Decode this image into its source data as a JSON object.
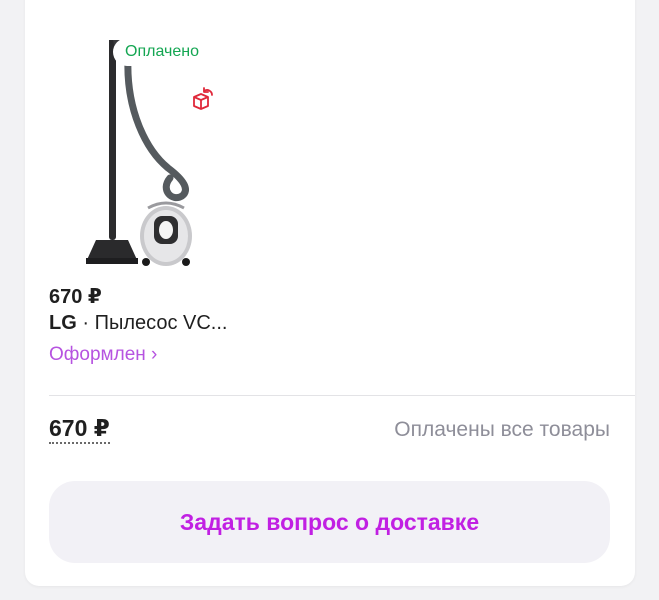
{
  "order": {
    "badge_paid": "Оплачено",
    "item": {
      "price": "670 ₽",
      "brand": "LG",
      "separator": " · ",
      "name": "Пылесос VC...",
      "status_link": "Оформлен ›",
      "image_icon": "vacuum-cleaner-image",
      "return_icon": "box-return-icon"
    },
    "total": {
      "price": "670 ₽",
      "status": "Оплачены все товары"
    },
    "ask_delivery_button": "Задать вопрос о доставке"
  },
  "colors": {
    "accent": "#c120e3",
    "link": "#b653e0",
    "paid_green": "#14a652",
    "return_red": "#e0283a",
    "muted_text": "#8e8e99",
    "button_bg": "#f2f1f6"
  }
}
